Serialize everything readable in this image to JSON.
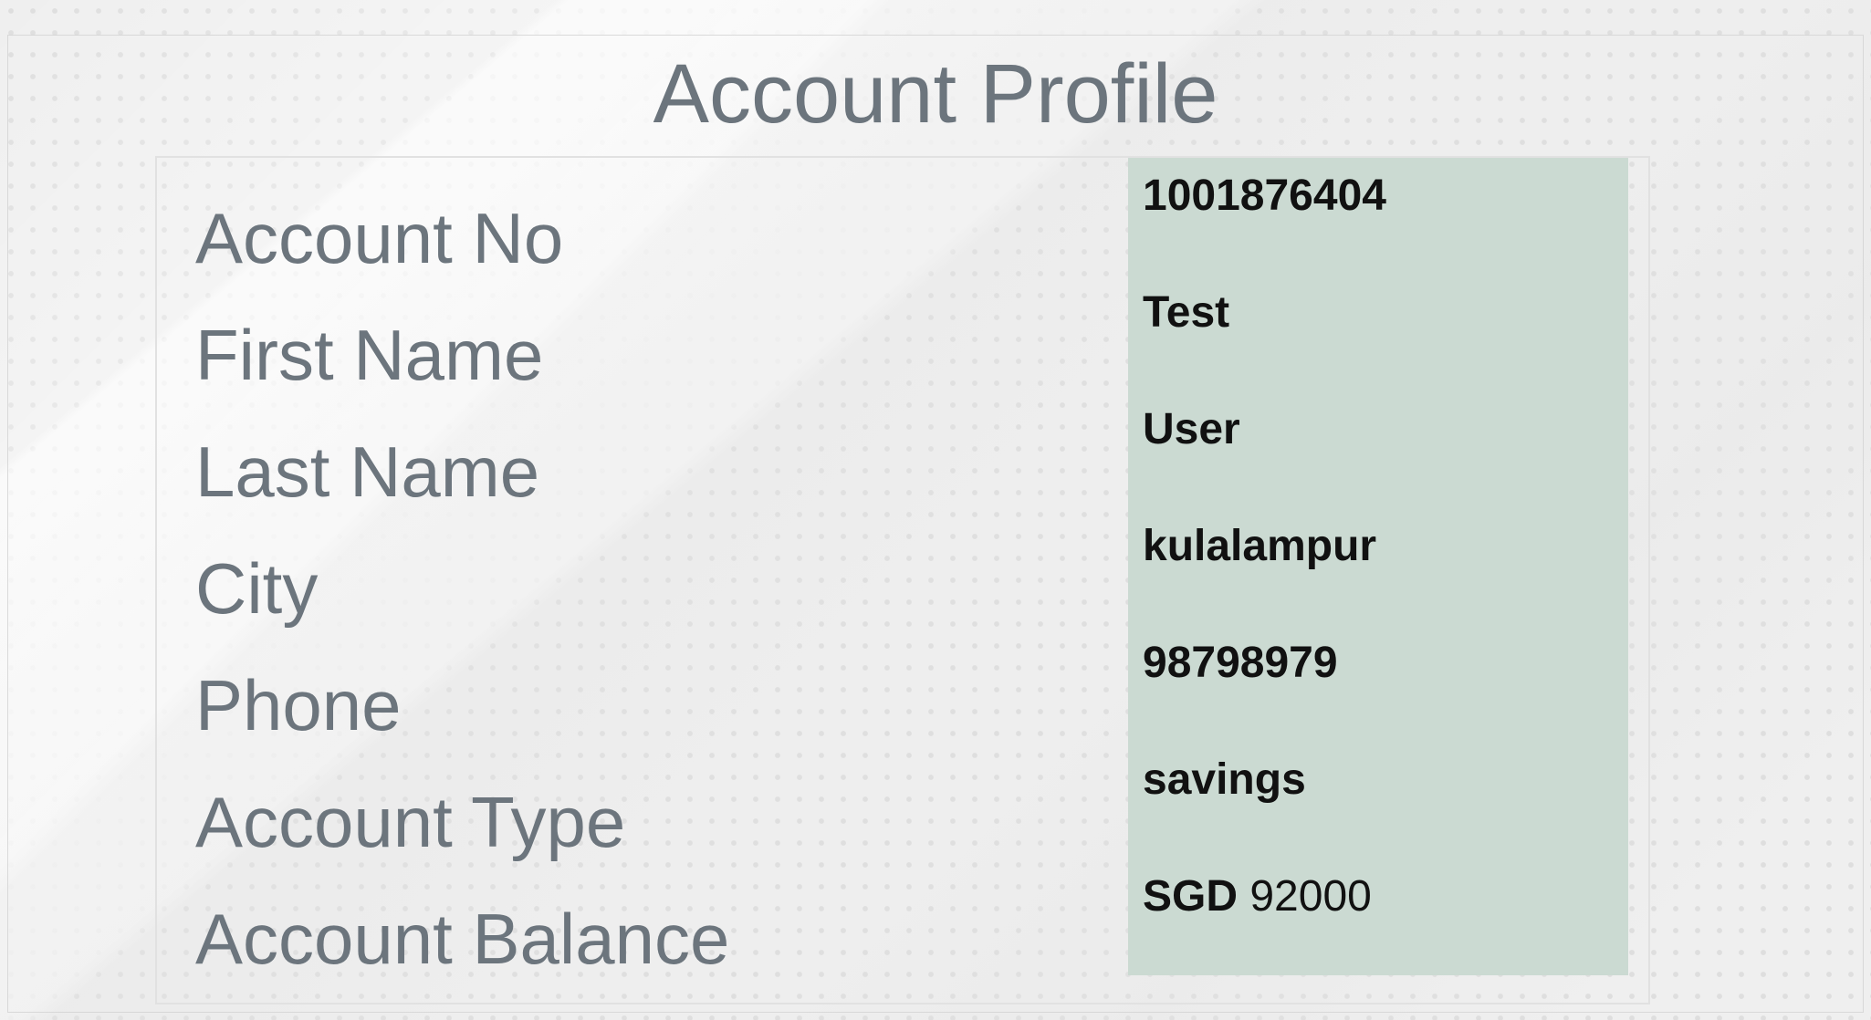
{
  "page": {
    "title": "Account Profile"
  },
  "profile": {
    "fields": [
      {
        "label": "Account No",
        "value": "1001876404"
      },
      {
        "label": "First Name",
        "value": "Test"
      },
      {
        "label": "Last Name",
        "value": "User"
      },
      {
        "label": "City",
        "value": "kulalampur"
      },
      {
        "label": "Phone",
        "value": "98798979"
      },
      {
        "label": "Account Type",
        "value": "savings"
      },
      {
        "label": "Account Balance",
        "currency": "SGD",
        "value": "92000"
      }
    ]
  },
  "colors": {
    "label_text": "#6c757d",
    "value_panel_bg": "#cbdad2",
    "value_text": "#111111",
    "page_bg": "#efefef"
  }
}
